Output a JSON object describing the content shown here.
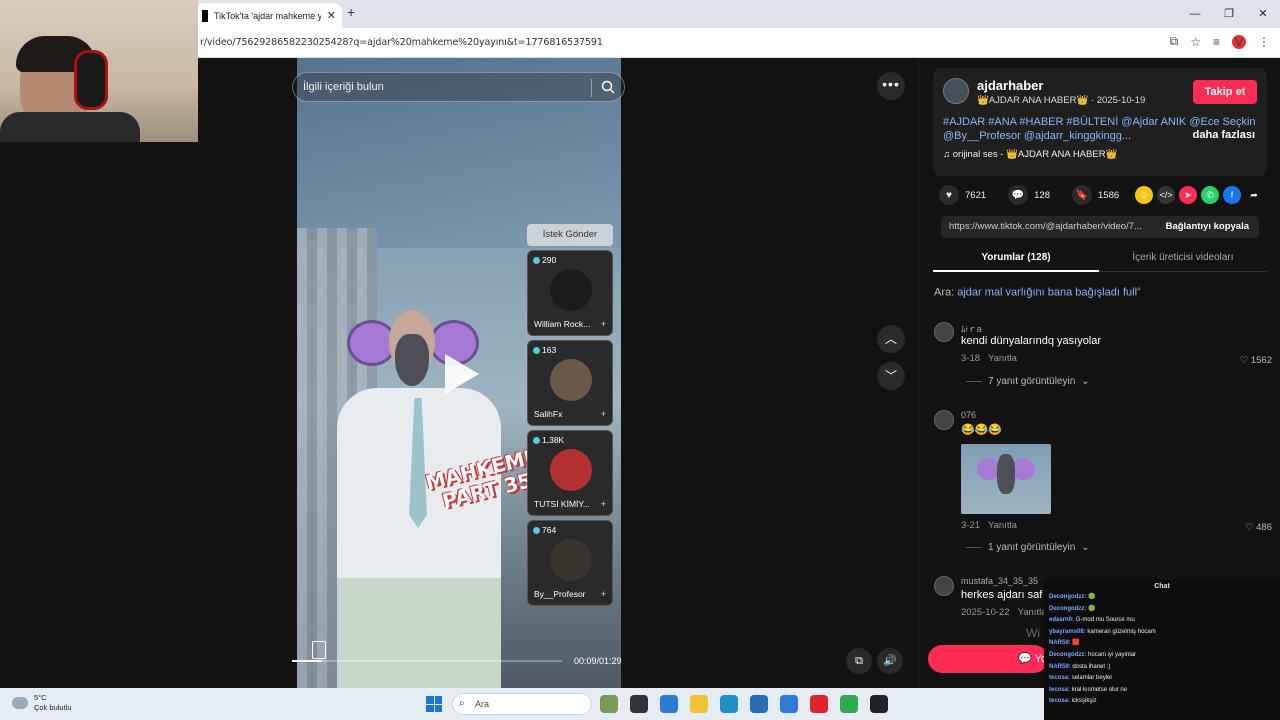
{
  "browser": {
    "tab_title": "TikTok'ta 'ajdar mahkeme yayın",
    "tab_close": "✕",
    "new_tab": "+",
    "url": "r/video/7562928658223025428?q=ajdar%20mahkeme%20yayını&t=1776816537591",
    "window_buttons": [
      "—",
      "❐",
      "✕"
    ],
    "profile_letter": "V"
  },
  "video": {
    "search_placeholder": "İlgili içeriği bulun",
    "overlay_text_line1": "MAHKEME",
    "overlay_text_line2": "PART 35",
    "time": "00:09/01:29",
    "progress": 0.11
  },
  "gifts": {
    "request_label": "İstek Gönder",
    "items": [
      {
        "count": "290",
        "name": "William Rock...",
        "avatar_color": "#1b1b1b"
      },
      {
        "count": "163",
        "name": "SalihFx",
        "avatar_color": "#6b5a4a"
      },
      {
        "count": "1,38K",
        "name": "TUTSİ KİMİY...",
        "avatar_color": "#b43131"
      },
      {
        "count": "764",
        "name": "By__Profesor",
        "avatar_color": "#3b3530"
      }
    ]
  },
  "panel": {
    "author": "ajdarhaber",
    "author_sub": "👑AJDAR ANA HABER👑 · 2025-10-19",
    "follow": "Takip et",
    "hashtags": "#AJDAR #ANA #HABER #BÜLTENİ @Ajdar ANIK @Ece Seçkin @By__Profesor @ajdarr_kinggkingg...",
    "more": "daha fazlası",
    "sound": "♫  orijinal ses - 👑AJDAR ANA HABER👑",
    "likes": "7621",
    "comments": "128",
    "saves": "1586",
    "link": "https://www.tiktok.com/@ajdarhaber/video/7...",
    "copy": "Bağlantıyı kopyala",
    "tab_comments": "Yorumlar (128)",
    "tab_creator": "İçerik üreticisi videoları",
    "related_prefix": "Ara:",
    "related_query": "ajdar mal varlığını bana bağışladı full"
  },
  "comments": [
    {
      "user": "ﾑ𝔦ｒa",
      "text": "kendi dünyalarındq yasıyolar",
      "date": "3-18",
      "reply": "Yanıtla",
      "likes": "1562",
      "replies": "7 yanıt görüntüleyin"
    },
    {
      "user": "076",
      "text": "😂😂😂",
      "date": "3-21",
      "reply": "Yanıtla",
      "likes": "486",
      "replies": "1 yanıt görüntüleyin"
    },
    {
      "user": "mustafa_34_35_35",
      "text": "herkes ajdarı saf g",
      "date": "2025-10-22",
      "reply": "Yanıtla"
    }
  ],
  "comment_button": "Yo",
  "watermark": "Wi",
  "chat": {
    "title": "Chat",
    "lines": [
      {
        "user": "Decongodzz:",
        "text": "🟢"
      },
      {
        "user": "Decongodzz:",
        "text": "🟢"
      },
      {
        "user": "edasrn0:",
        "text": "G-mod mu Source mu"
      },
      {
        "user": "ybayrams08:",
        "text": "kameran güzelmiş hocam"
      },
      {
        "user": "NAR59:",
        "text": "🟥"
      },
      {
        "user": "Decongodzz:",
        "text": "hocam iyi yayınlar"
      },
      {
        "user": "NAR59:",
        "text": "dosta ihanet :)"
      },
      {
        "user": "tecosa:",
        "text": "selamlar beyler"
      },
      {
        "user": "tecosa:",
        "text": "kral kısmetse olur ne"
      },
      {
        "user": "tecosa:",
        "text": "icksşikşiz"
      }
    ]
  },
  "taskbar": {
    "temp": "5°C",
    "weather": "Çok bulutlu",
    "search": "Ara",
    "apps": [
      "#7a9a5a",
      "#333333",
      "#2b7bd4",
      "#f1c232",
      "#1e90c8",
      "#2a6db5",
      "#2f7ad9",
      "#e0242b",
      "#34a853",
      "#222222"
    ]
  }
}
